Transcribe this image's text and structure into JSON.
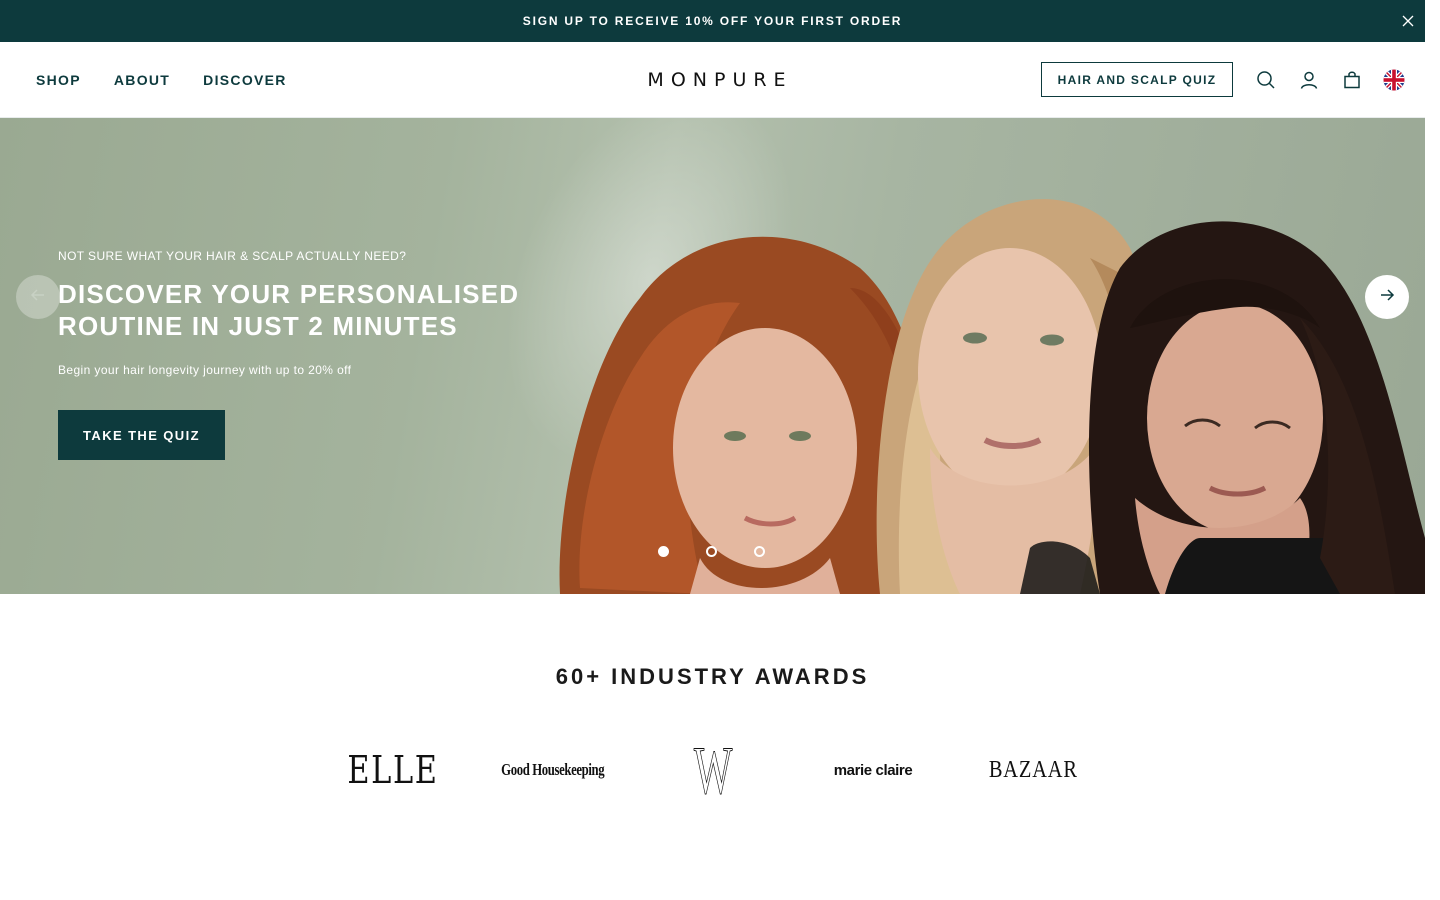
{
  "announcement": {
    "text": "SIGN UP TO RECEIVE 10% OFF YOUR FIRST ORDER",
    "close_icon": "close-icon"
  },
  "header": {
    "nav": [
      {
        "label": "SHOP"
      },
      {
        "label": "ABOUT"
      },
      {
        "label": "DISCOVER"
      }
    ],
    "logo": "MONPURE",
    "quiz_button": "HAIR AND SCALP QUIZ",
    "icons": [
      "search-icon",
      "account-icon",
      "cart-icon",
      "uk-flag-icon"
    ]
  },
  "hero": {
    "eyebrow": "NOT SURE WHAT YOUR HAIR & SCALP ACTUALLY NEED?",
    "headline": "DISCOVER YOUR PERSONALISED ROUTINE IN JUST 2 MINUTES",
    "subline": "Begin your hair longevity journey with up to 20% off",
    "cta": "TAKE THE QUIZ",
    "slides_total": 3,
    "active_slide": 1
  },
  "awards": {
    "title": "60+ INDUSTRY AWARDS",
    "logos": [
      {
        "name": "elle-logo",
        "text": "ELLE"
      },
      {
        "name": "good-housekeeping-logo",
        "text": "Good Housekeeping"
      },
      {
        "name": "w-magazine-logo",
        "text": "W"
      },
      {
        "name": "marie-claire-logo",
        "text": "marie claire"
      },
      {
        "name": "harpers-bazaar-logo",
        "text": "BAZAAR"
      }
    ]
  },
  "colors": {
    "brand": "#0d3a3d",
    "hero_bg": "#a4b39d",
    "white": "#ffffff"
  }
}
